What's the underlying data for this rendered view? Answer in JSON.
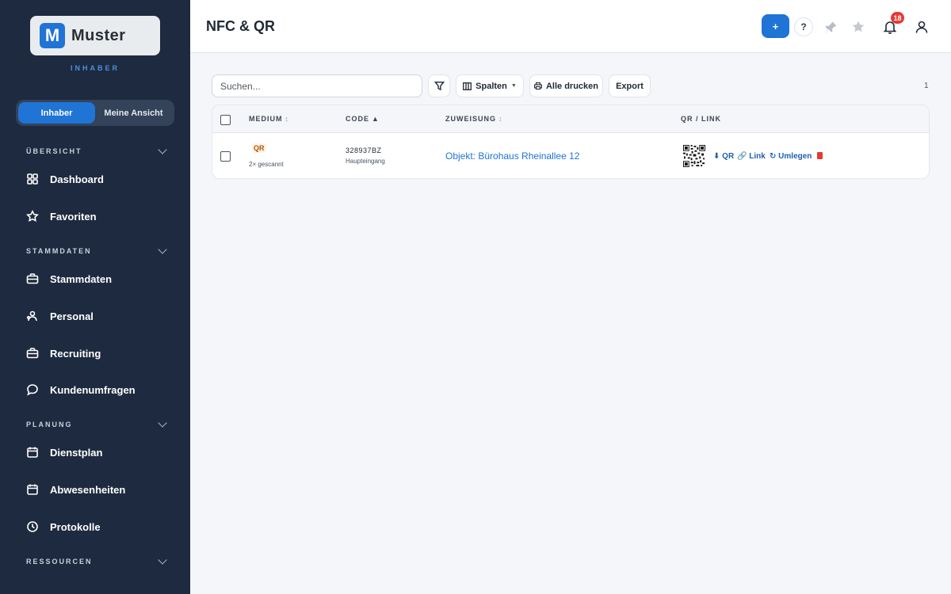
{
  "app": {
    "logo_text": "Muster",
    "role_caption": "INHABER"
  },
  "view_switch": {
    "options": [
      "Inhaber",
      "Meine Ansicht"
    ],
    "active": "Inhaber"
  },
  "sidebar": {
    "sections": [
      {
        "label": "ÜBERSICHT"
      },
      {
        "label": "STAMMDATEN"
      },
      {
        "label": "PLANUNG"
      },
      {
        "label": "RESSOURCEN"
      }
    ],
    "items": [
      {
        "label": "Dashboard",
        "icon": "grid-icon"
      },
      {
        "label": "Favoriten",
        "icon": "star-icon"
      },
      {
        "label": "Stammdaten",
        "icon": "briefcase-icon"
      },
      {
        "label": "Personal",
        "icon": "people-icon"
      },
      {
        "label": "Recruiting",
        "icon": "briefcase-icon"
      },
      {
        "label": "Kundenumfragen",
        "icon": "chat-icon"
      },
      {
        "label": "Dienstplan",
        "icon": "calendar-icon"
      },
      {
        "label": "Abwesenheiten",
        "icon": "calendar-icon"
      },
      {
        "label": "Protokolle",
        "icon": "clock-icon"
      }
    ]
  },
  "header": {
    "title": "NFC & QR",
    "add_label": "+",
    "help_label": "?",
    "notification_count": "18"
  },
  "toolbar": {
    "search_placeholder": "Suchen...",
    "columns_label": "Spalten",
    "print_label": "Alle drucken",
    "export_label": "Export",
    "result_count": "1"
  },
  "table": {
    "columns": [
      "MEDIUM",
      "CODE",
      "ZUWEISUNG",
      "QR / LINK"
    ],
    "rows": [
      {
        "medium": "QR",
        "scans": "2× gescannt",
        "code": "328937BZ",
        "location": "Haupteingang",
        "assignment": "Objekt: Bürohaus Rheinallee 12",
        "actions": {
          "qr": "QR",
          "link": "Link",
          "move": "Umlegen"
        }
      }
    ]
  },
  "colors": {
    "sidebar_bg": "#1e2a3f",
    "accent": "#1f74d6",
    "badge": "#e53935"
  }
}
